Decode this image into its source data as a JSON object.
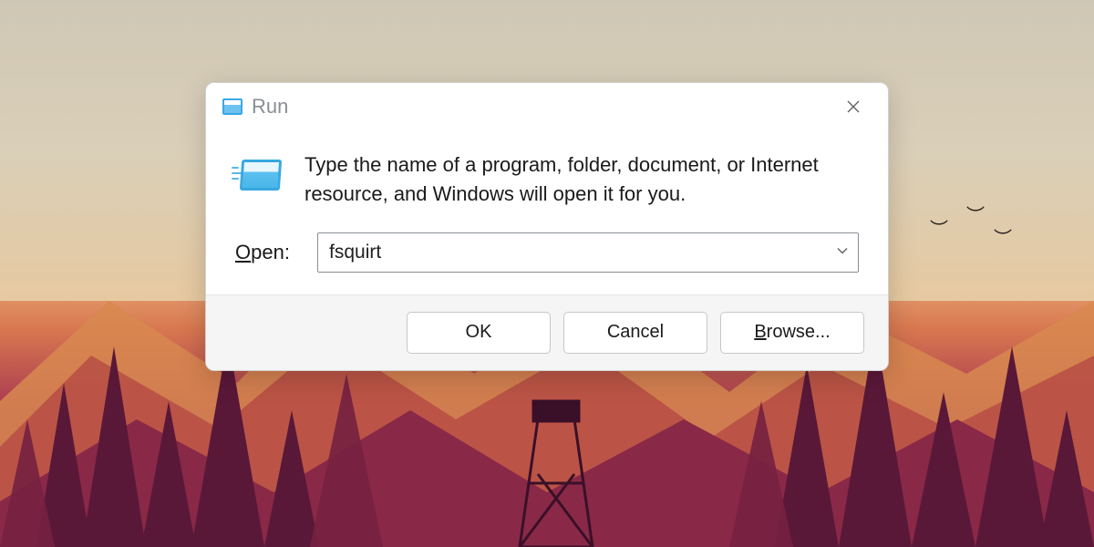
{
  "dialog": {
    "title": "Run",
    "description": "Type the name of a program, folder, document, or Internet resource, and Windows will open it for you.",
    "open_label_pre": "O",
    "open_label_post": "pen:",
    "input_value": "fsquirt",
    "buttons": {
      "ok": "OK",
      "cancel": "Cancel",
      "browse_pre": "B",
      "browse_post": "rowse..."
    }
  }
}
